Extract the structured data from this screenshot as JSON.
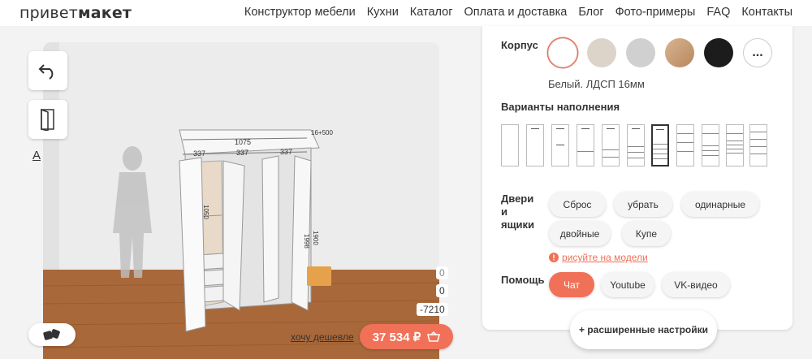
{
  "header": {
    "logo_light": "привет",
    "logo_bold": "макет",
    "nav": [
      "Конструктор мебели",
      "Кухни",
      "Каталог",
      "Оплата и доставка",
      "Блог",
      "Фото-примеры",
      "FAQ",
      "Контакты"
    ]
  },
  "viewport": {
    "dimensions": {
      "total_width": "1075",
      "col1": "337",
      "col2": "337",
      "col3": "337",
      "depth_note": "16+500",
      "inner_height": "1050",
      "height_a": "1998",
      "height_b": "1900"
    },
    "coords": [
      "0",
      "0",
      "-7210"
    ],
    "text_tool": "A",
    "cheaper_link": "хочу дешевле",
    "price": "37 534 ₽"
  },
  "panel": {
    "body_label": "Корпус",
    "swatches": [
      {
        "name": "white",
        "color": "#ffffff"
      },
      {
        "name": "beige",
        "color": "#dcd3c9"
      },
      {
        "name": "grey",
        "color": "#d0d0d0"
      },
      {
        "name": "oak",
        "color": "#c9a27d"
      },
      {
        "name": "black",
        "color": "#1c1c1c"
      }
    ],
    "more_label": "...",
    "material_name": "Белый. ЛДСП 16мм",
    "fill_label": "Варианты наполнения",
    "doors_label_1": "Двери",
    "doors_label_2": "и",
    "doors_label_3": "ящики",
    "door_buttons": [
      "Сброс",
      "убрать",
      "одинарные",
      "двойные",
      "Купе"
    ],
    "draw_link": "рисуйте на модели",
    "help_label": "Помощь",
    "help_buttons": [
      "Чат",
      "Youtube",
      "VK-видео"
    ],
    "advanced": "+ расширенные настройки"
  },
  "colors": {
    "accent": "#f07158"
  }
}
